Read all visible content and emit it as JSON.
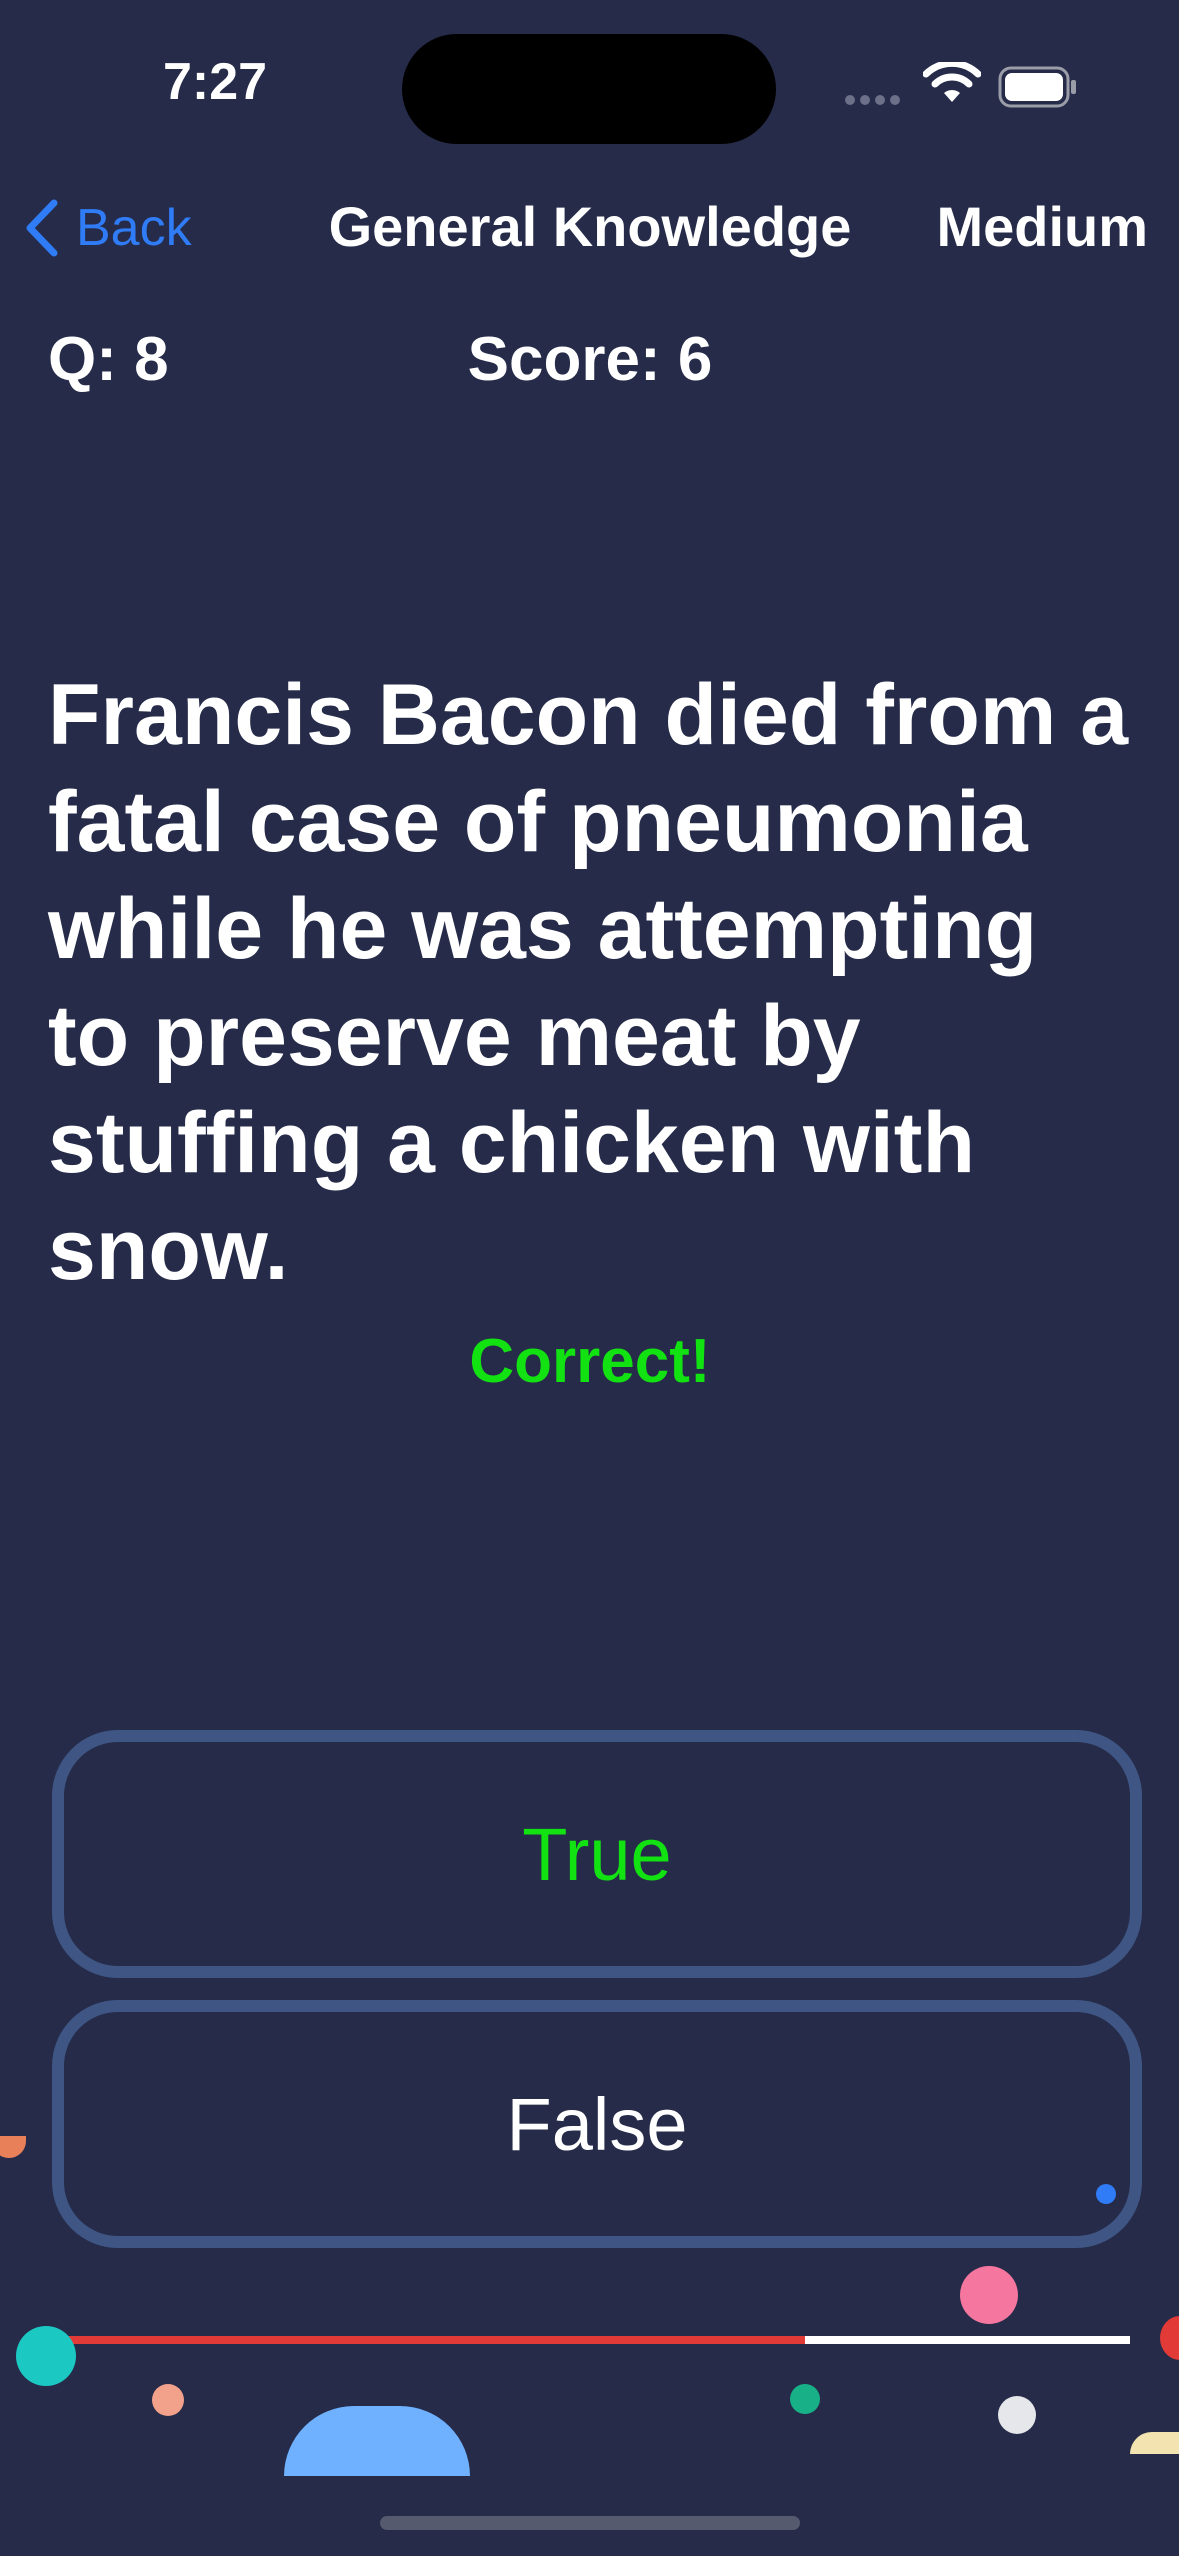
{
  "status_bar": {
    "time": "7:27",
    "icons": [
      "signal-dots-icon",
      "wifi-icon",
      "battery-icon"
    ]
  },
  "nav": {
    "back_label": "Back",
    "title": "General Knowledge",
    "difficulty": "Medium"
  },
  "quiz": {
    "question_counter": "Q: 8",
    "score": "Score: 6",
    "question": "Francis Bacon died from a fatal case of pneumonia while he was attempting to preserve meat by stuffing a chicken with snow.",
    "feedback": "Correct!",
    "answers": {
      "true_label": "True",
      "false_label": "False"
    },
    "progress_fraction": 0.7
  },
  "colors": {
    "background": "#252B48",
    "accent_blue": "#2F7CF6",
    "correct_green": "#12E212",
    "button_border": "#3F5584",
    "progress_fill": "#E23A36",
    "progress_track": "#FFFFFF"
  }
}
